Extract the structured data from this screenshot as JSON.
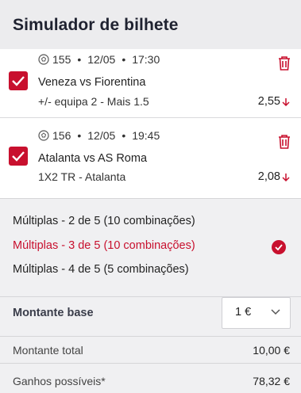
{
  "header": {
    "title": "Simulador de bilhete"
  },
  "bets": [
    {
      "event_id": "155",
      "date": "12/05",
      "time": "17:30",
      "match": "Veneza vs Fiorentina",
      "market": "+/- equipa 2 - Mais 1.5",
      "odds": "2,55",
      "selected": true
    },
    {
      "event_id": "156",
      "date": "12/05",
      "time": "19:45",
      "match": "Atalanta vs AS Roma",
      "market": "1X2 TR - Atalanta",
      "odds": "2,08",
      "selected": true
    }
  ],
  "combinations": [
    {
      "label": "Múltiplas - 2 de 5 (10 combinações)",
      "active": false
    },
    {
      "label": "Múltiplas - 3 de 5 (10 combinações)",
      "active": true
    },
    {
      "label": "Múltiplas - 4 de 5 (5 combinações)",
      "active": false
    }
  ],
  "amount": {
    "label": "Montante base",
    "value": "1 €"
  },
  "summary": {
    "total_label": "Montante total",
    "total_value": "10,00 €",
    "winnings_label": "Ganhos possíveis*",
    "winnings_value": "78,32 €"
  },
  "colors": {
    "accent": "#c8102e",
    "header_bg": "#ececee",
    "panel_bg": "#f0f0f2"
  },
  "icons": {
    "meta": "soccer-ball-icon",
    "delete": "trash-icon",
    "odds_trend": "arrow-down-icon",
    "check": "check-icon",
    "select": "chevron-down-icon"
  }
}
